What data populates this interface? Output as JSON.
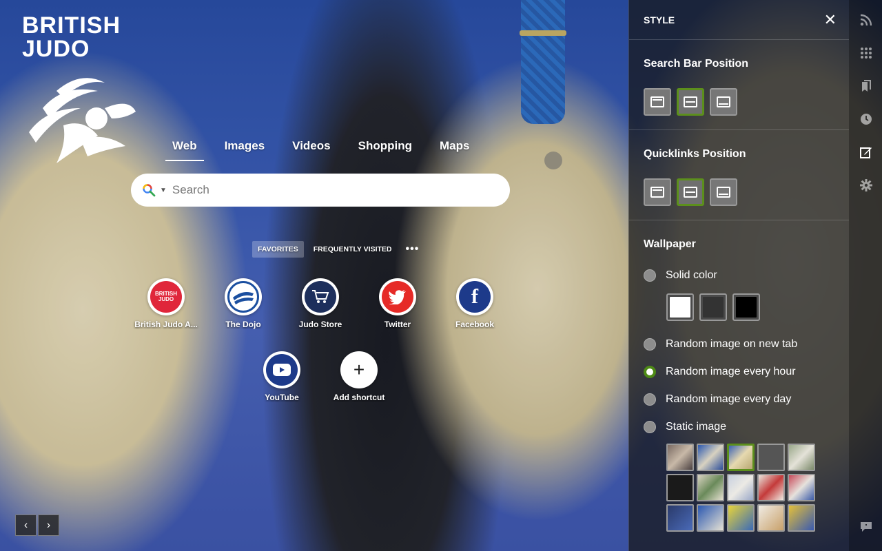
{
  "brand": {
    "line1": "BRITISH",
    "line2": "JUDO"
  },
  "tabs": [
    {
      "label": "Web",
      "active": true
    },
    {
      "label": "Images",
      "active": false
    },
    {
      "label": "Videos",
      "active": false
    },
    {
      "label": "Shopping",
      "active": false
    },
    {
      "label": "Maps",
      "active": false
    }
  ],
  "search": {
    "placeholder": "Search"
  },
  "quicklinks": {
    "tabs": {
      "favorites": "FAVORITES",
      "frequent": "FREQUENTLY VISITED",
      "more": "•••"
    },
    "items": [
      {
        "label": "British Judo A...",
        "icon": "british-judo-icon"
      },
      {
        "label": "The Dojo",
        "icon": "dojo-icon"
      },
      {
        "label": "Judo Store",
        "icon": "cart-icon"
      },
      {
        "label": "Twitter",
        "icon": "twitter-icon"
      },
      {
        "label": "Facebook",
        "icon": "facebook-icon"
      },
      {
        "label": "YouTube",
        "icon": "youtube-icon"
      },
      {
        "label": "Add shortcut",
        "icon": "plus-icon"
      }
    ]
  },
  "pager": {
    "prev": "‹",
    "next": "›"
  },
  "style_panel": {
    "title": "STYLE",
    "close": "✕",
    "search_bar_position": {
      "title": "Search Bar Position",
      "selected": "middle"
    },
    "quicklinks_position": {
      "title": "Quicklinks Position",
      "selected": "middle"
    },
    "wallpaper": {
      "title": "Wallpaper",
      "options": {
        "solid": "Solid color",
        "random_tab": "Random image on new tab",
        "random_hour": "Random image every hour",
        "random_day": "Random image every day",
        "static": "Static image"
      },
      "selected": "random_hour",
      "swatch_colors": [
        "#ffffff",
        "#333333",
        "#000000"
      ]
    }
  },
  "colors": {
    "accent_green": "#5c8f1c",
    "panel_bg": "#161616"
  }
}
